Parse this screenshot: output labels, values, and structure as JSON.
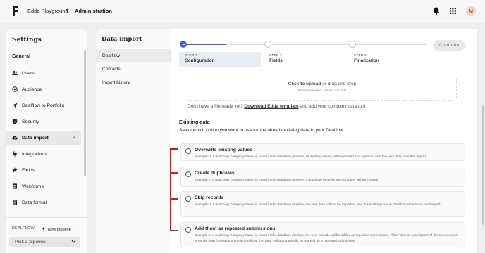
{
  "topbar": {
    "workspace": "Edda Playground",
    "section": "Administration",
    "avatar_initial": "M"
  },
  "settings": {
    "title": "Settings",
    "group": "General",
    "items": [
      {
        "label": "Users",
        "icon": "users-icon"
      },
      {
        "label": "Audience",
        "icon": "audience-icon"
      },
      {
        "label": "Dealflow to Portfolio",
        "icon": "send-icon"
      },
      {
        "label": "Security",
        "icon": "shield-icon"
      },
      {
        "label": "Data import",
        "icon": "cloud-upload-icon",
        "active": true
      },
      {
        "label": "Integrations",
        "icon": "plug-icon"
      },
      {
        "label": "Fields",
        "icon": "star-icon"
      },
      {
        "label": "Webforms",
        "icon": "webforms-icon"
      },
      {
        "label": "Data format",
        "icon": "data-format-icon"
      }
    ],
    "dealflow_label": "DEALFLOW",
    "new_pipeline": "New pipeline",
    "pick_pipeline": "Pick a pipeline"
  },
  "data_import": {
    "title": "Data import",
    "items": [
      "Dealflow",
      "Contacts",
      "Import history"
    ]
  },
  "stepper": {
    "steps": [
      {
        "number": "STEP 1",
        "title": "Configuration"
      },
      {
        "number": "STEP 2",
        "title": "Fields"
      },
      {
        "number": "STEP 3",
        "title": "Finalization"
      }
    ],
    "continue_label": "Continue"
  },
  "upload": {
    "link": "Click to upload",
    "rest": " or drag and drop",
    "formats": "Format allowed: .xls(x) .csv .ods"
  },
  "template": {
    "prefix": "Don't have a file ready yet? ",
    "link": "Download Edda template",
    "suffix": " and add your company data to it"
  },
  "existing": {
    "title": "Existing data",
    "subtitle": "Select which option you want to use for the already existing data in your Dealflow.",
    "options": [
      {
        "title": "Overwrite existing values",
        "desc": "Example: If a matching 'company name' is found in the database pipeline, all existing values will be erased and replaced with the new data from this import."
      },
      {
        "title": "Create duplicates",
        "desc": "Example: If a matching 'company name' is found in the database pipeline, a duplicate entry for the company will be created"
      },
      {
        "title": "Skip records",
        "desc": "Example: If a matching 'company name' is found in the database pipeline, the new data will not be imported, and the existing data in Dealflow will remain unchanged."
      },
      {
        "title": "Add them as repeated submissions",
        "desc": "Example: If a matching 'company name' is found in the database pipeline, the new records will be added as repeated submissions. If the 'date of submission' of the new records is earlier than the existing one in Dealflow, the 'date' will automatically be marked as a repeated submission."
      }
    ]
  },
  "colors": {
    "accent": "#4b5fd6",
    "annotation": "#c0221e",
    "check": "#3d8b4d"
  }
}
